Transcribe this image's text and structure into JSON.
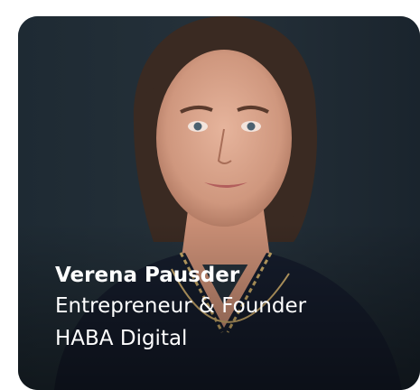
{
  "profile": {
    "name": "Verena Pausder",
    "role": "Entrepreneur & Founder",
    "company": "HABA Digital"
  },
  "colors": {
    "background": "#ffffff",
    "card_backdrop": "#1c2630",
    "text": "#ffffff"
  }
}
